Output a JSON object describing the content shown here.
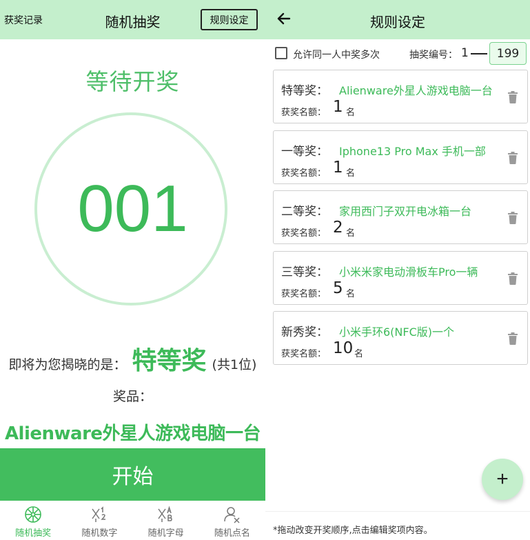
{
  "left": {
    "header": {
      "records_label": "获奖记录",
      "title": "随机抽奖",
      "rules_button": "规则设定"
    },
    "status": "等待开奖",
    "number": "001",
    "reveal": {
      "prefix": "即将为您揭晓的是：",
      "prize_level": "特等奖",
      "count": "(共1位)"
    },
    "prize_label": "奖品：",
    "prize_name": "Alienware外星人游戏电脑一台",
    "start_button": "开始",
    "tabs": [
      {
        "label": "随机抽奖",
        "icon": "lottery-wheel-icon",
        "active": true
      },
      {
        "label": "随机数字",
        "icon": "random-number-icon",
        "active": false
      },
      {
        "label": "随机字母",
        "icon": "random-letter-icon",
        "active": false
      },
      {
        "label": "随机点名",
        "icon": "random-rollcall-icon",
        "active": false
      }
    ]
  },
  "right": {
    "header": {
      "back_icon": "arrow-left-icon",
      "title": "规则设定"
    },
    "options": {
      "allow_multiple_label": "允许同一人中奖多次",
      "allow_multiple_checked": false,
      "number_label": "抽奖编号：",
      "number_start": "1",
      "number_end": "199"
    },
    "prizes": [
      {
        "level": "特等奖：",
        "name": "Alienware外星人游戏电脑一台",
        "quota_label": "获奖名额：",
        "quota": "1",
        "unit": "名"
      },
      {
        "level": "一等奖：",
        "name": "Iphone13 Pro Max 手机一部",
        "quota_label": "获奖名额：",
        "quota": "1",
        "unit": "名"
      },
      {
        "level": "二等奖：",
        "name": "家用西门子双开电冰箱一台",
        "quota_label": "获奖名额：",
        "quota": "2",
        "unit": "名"
      },
      {
        "level": "三等奖：",
        "name": "小米米家电动滑板车Pro一辆",
        "quota_label": "获奖名额：",
        "quota": "5",
        "unit": "名"
      },
      {
        "level": "新秀奖：",
        "name": "小米手环6(NFC版)一个",
        "quota_label": "获奖名额：",
        "quota": "10",
        "unit": "名"
      }
    ],
    "fab_label": "+",
    "footnote": "*拖动改变开奖顺序,点击编辑奖项内容。"
  },
  "colors": {
    "accent": "#3dba59",
    "header_bg": "#c4efcc",
    "ring": "#c9eed1",
    "button": "#42bd5e"
  }
}
